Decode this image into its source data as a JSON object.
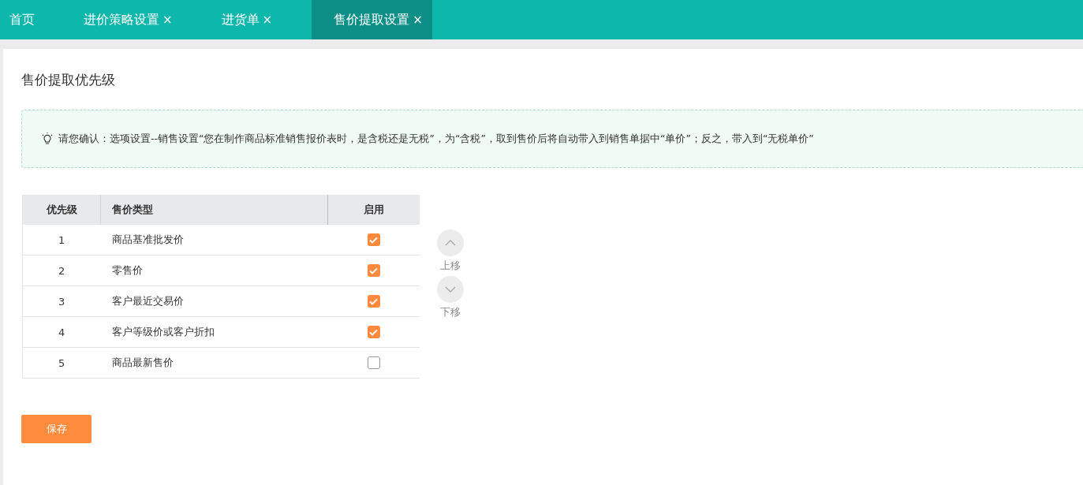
{
  "tabs": [
    {
      "label": "首页",
      "selected": false
    },
    {
      "label": "进价策略设置",
      "close": "×",
      "selected": false
    },
    {
      "label": "进货单",
      "close": "×",
      "selected": false
    },
    {
      "label": "售价提取设置",
      "close": "×",
      "selected": true
    }
  ],
  "page_title": "售价提取优先级",
  "notice": "请您确认：选项设置--销售设置“您在制作商品标准销售报价表时，是含税还是无税”，为“含税”，取到售价后将自动带入到销售单据中“单价”；反之，带入到“无税单价”",
  "table": {
    "columns": [
      "优先级",
      "售价类型",
      "启用"
    ],
    "rows": [
      {
        "priority": "1",
        "type": "商品基准批发价",
        "enabled": true
      },
      {
        "priority": "2",
        "type": "零售价",
        "enabled": true
      },
      {
        "priority": "3",
        "type": "客户最近交易价",
        "enabled": true
      },
      {
        "priority": "4",
        "type": "客户等级价或客户折扣",
        "enabled": true
      },
      {
        "priority": "5",
        "type": "商品最新售价",
        "enabled": false
      }
    ]
  },
  "move_buttons": [
    {
      "kind": "up",
      "label": "上移",
      "disabled": true
    },
    {
      "kind": "down",
      "label": "下移",
      "disabled": true
    }
  ],
  "save_button": "保存"
}
